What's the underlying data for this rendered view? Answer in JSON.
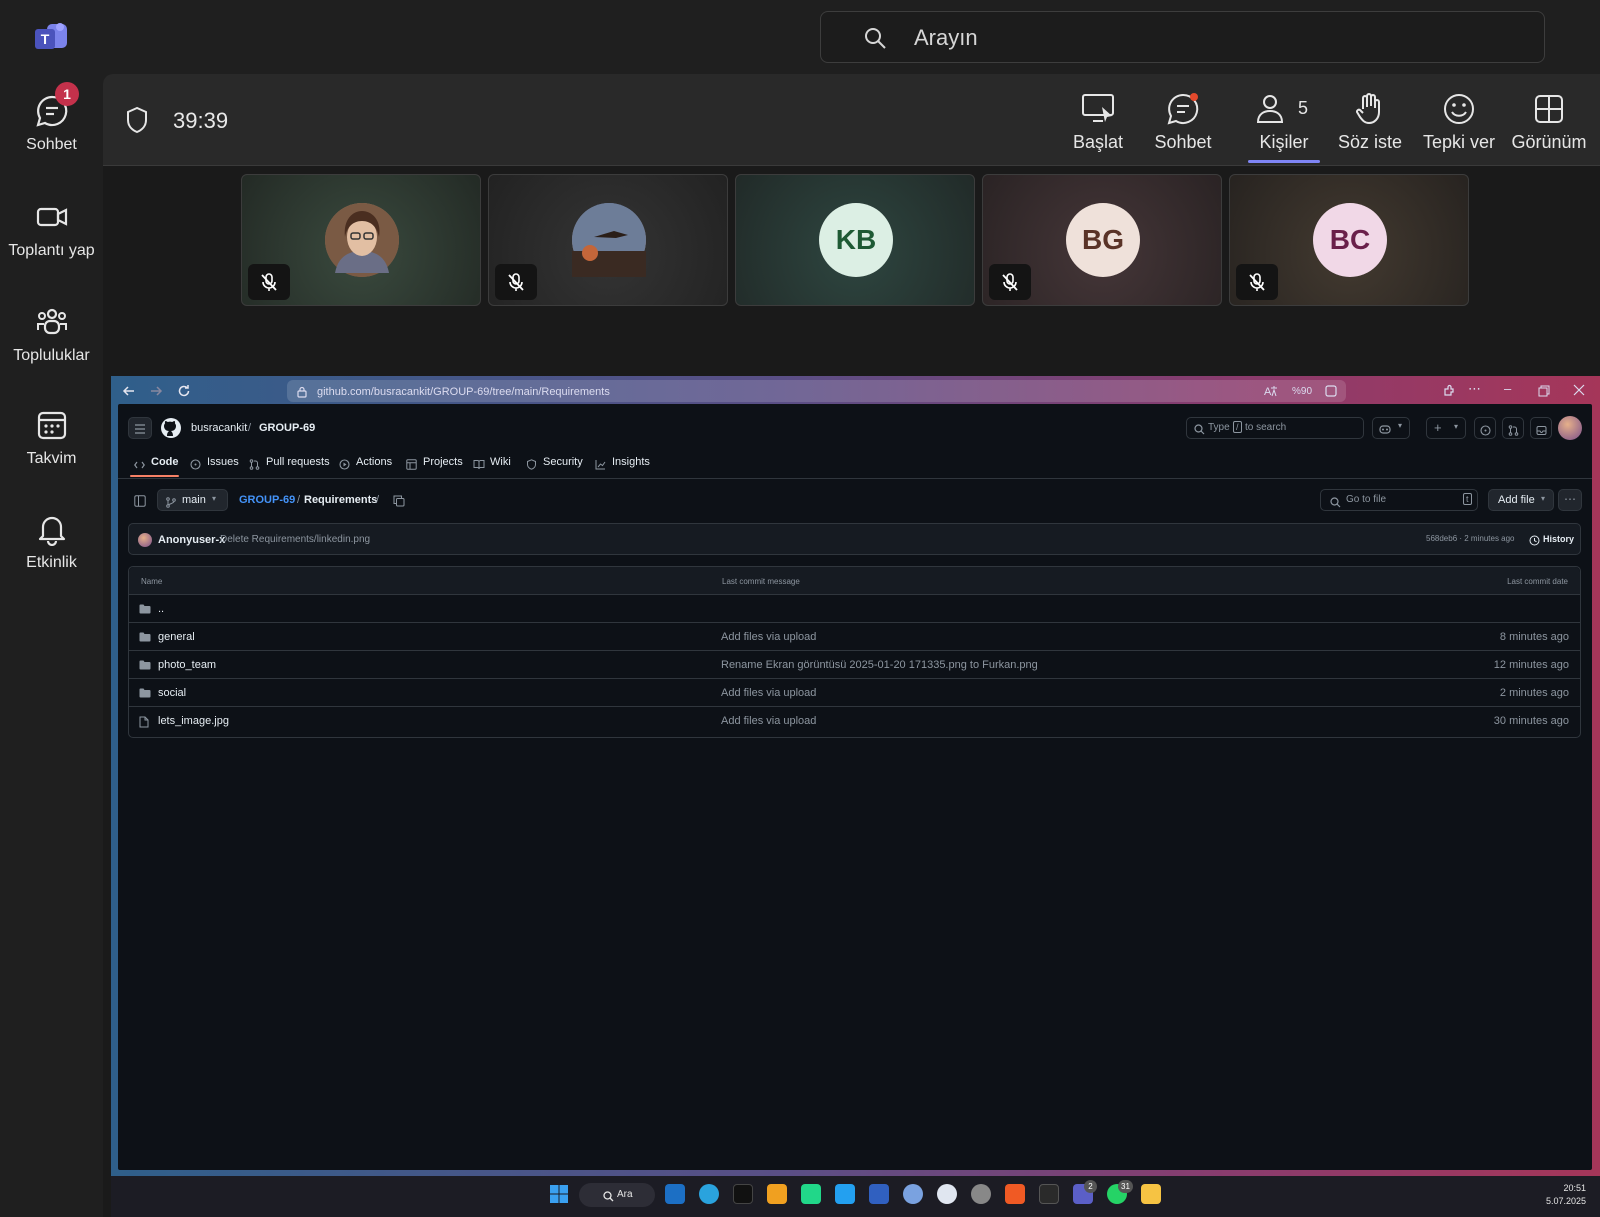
{
  "teams": {
    "rail": [
      {
        "label": "Sohbet",
        "badge": "1"
      },
      {
        "label": "Toplantı yap"
      },
      {
        "label": "Topluluklar"
      },
      {
        "label": "Takvim"
      },
      {
        "label": "Etkinlik"
      }
    ],
    "search_placeholder": "Arayın",
    "meeting": {
      "timer": "39:39",
      "toolbar": [
        {
          "label": "Başlat"
        },
        {
          "label": "Sohbet"
        },
        {
          "label": "Kişiler",
          "count": "5"
        },
        {
          "label": "Söz iste"
        },
        {
          "label": "Tepki ver"
        },
        {
          "label": "Görünüm"
        }
      ],
      "participants": [
        {
          "initials": "",
          "muted": true
        },
        {
          "initials": "",
          "muted": true
        },
        {
          "initials": "KB",
          "muted": false,
          "color": "#dcefe4",
          "text_color": "#1e5a34"
        },
        {
          "initials": "BG",
          "muted": true,
          "color": "#efe1da",
          "text_color": "#5a3327"
        },
        {
          "initials": "BC",
          "muted": true,
          "color": "#f1d8e7",
          "text_color": "#6a1f4a"
        }
      ]
    }
  },
  "browser": {
    "url": "github.com/busracankit/GROUP-69/tree/main/Requirements",
    "zoom": "%90"
  },
  "github": {
    "owner": "busracankit",
    "repo": "GROUP-69",
    "search_placeholder_pre": "Type",
    "search_placeholder_key": "/",
    "search_placeholder_post": "to search",
    "tabs": [
      "Code",
      "Issues",
      "Pull requests",
      "Actions",
      "Projects",
      "Wiki",
      "Security",
      "Insights"
    ],
    "branch": "main",
    "breadcrumb_repo": "GROUP-69",
    "breadcrumb_sep": "/",
    "breadcrumb_dir": "Requirements",
    "breadcrumb_trail": "/",
    "goto_file": "Go to file",
    "goto_key": "t",
    "add_file": "Add file",
    "commit": {
      "author": "Anonyuser-x",
      "message": "Delete Requirements/linkedin.png",
      "meta": "568deb6 · 2 minutes ago",
      "history": "History"
    },
    "table_headers": {
      "name": "Name",
      "message": "Last commit message",
      "date": "Last commit date"
    },
    "rows": [
      {
        "name": "..",
        "message": "",
        "date": "",
        "type": "folder"
      },
      {
        "name": "general",
        "message": "Add files via upload",
        "date": "8 minutes ago",
        "type": "folder"
      },
      {
        "name": "photo_team",
        "message": "Rename Ekran görüntüsü 2025-01-20 171335.png to Furkan.png",
        "date": "12 minutes ago",
        "type": "folder"
      },
      {
        "name": "social",
        "message": "Add files via upload",
        "date": "2 minutes ago",
        "type": "folder"
      },
      {
        "name": "lets_image.jpg",
        "message": "Add files via upload",
        "date": "30 minutes ago",
        "type": "file"
      }
    ]
  },
  "taskbar": {
    "search": "Ara",
    "teams_badge": "2",
    "whatsapp_badge": "31",
    "time": "20:51",
    "date": "5.07.2025"
  }
}
